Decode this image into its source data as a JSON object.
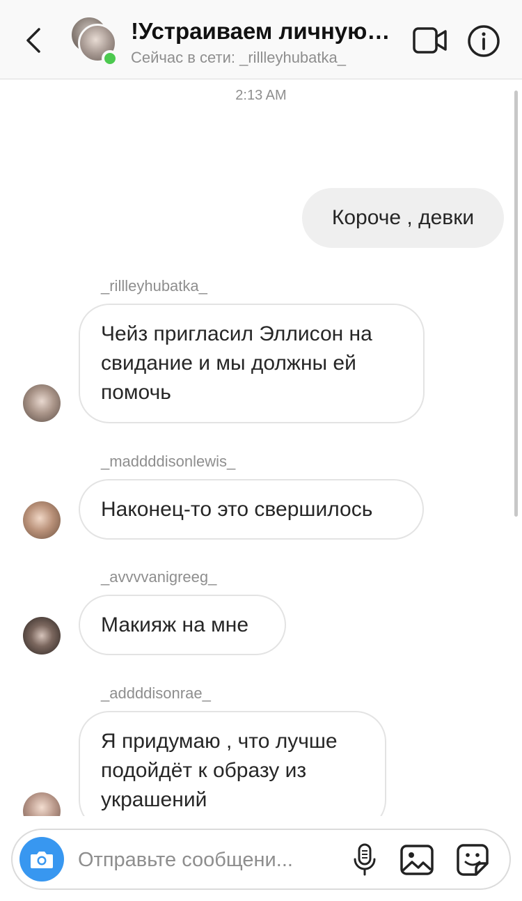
{
  "header": {
    "title": "!Устраиваем личную…",
    "subtitle": "Сейчас в сети: _rillleyhubatka_",
    "back_icon": "chevron-left-icon",
    "video_icon": "video-camera-icon",
    "info_icon": "info-icon"
  },
  "chat": {
    "timestamp": "2:13 AM",
    "outgoing": [
      {
        "text": "Короче , девки"
      }
    ],
    "incoming": [
      {
        "sender": "_rillleyhubatka_",
        "text": "Чейз пригласил Эллисон на свидание и мы должны ей помочь"
      },
      {
        "sender": "_maddddisonlewis_",
        "text": "Наконец-то это свершилось"
      },
      {
        "sender": "_avvvvanigreeg_",
        "text": "Макияж на мне"
      },
      {
        "sender": "_addddisonrae_",
        "text": "Я придумаю , что лучше подойдёт к образу из украшений"
      }
    ]
  },
  "composer": {
    "placeholder": "Отправьте сообщени...",
    "camera_icon": "camera-icon",
    "mic_icon": "microphone-icon",
    "gallery_icon": "image-gallery-icon",
    "sticker_icon": "sticker-icon",
    "accent_color": "#3897f0"
  },
  "colors": {
    "online": "#4cc94f",
    "outgoing_bubble": "#efefef",
    "incoming_border": "#e3e3e3"
  }
}
